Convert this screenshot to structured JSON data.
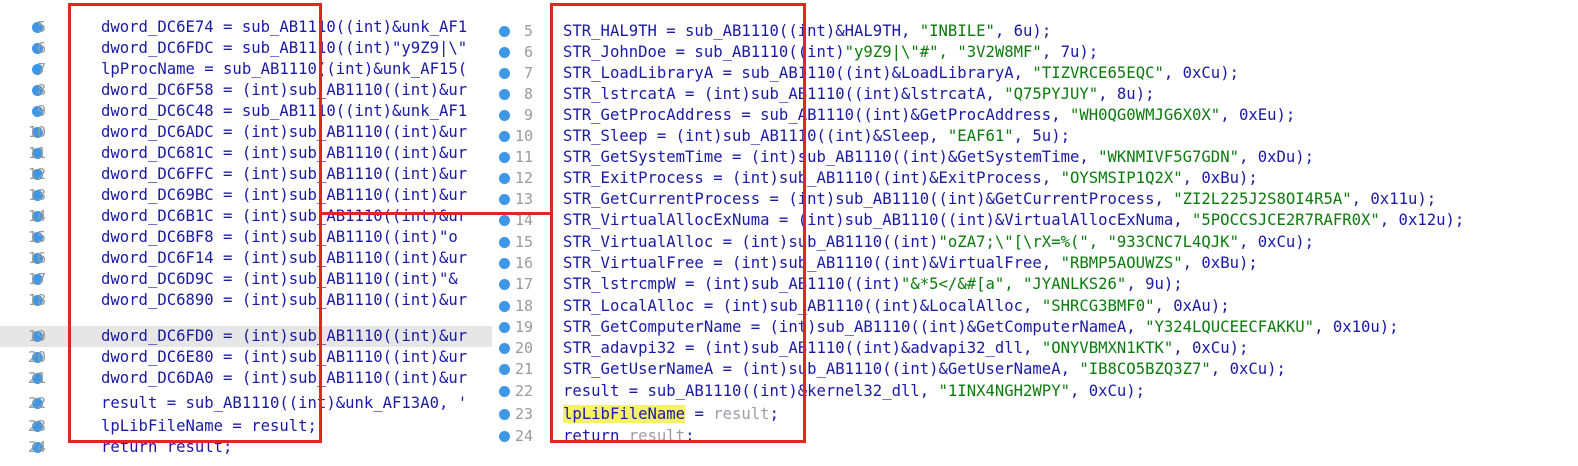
{
  "left_pane": {
    "lines": [
      {
        "num": "5",
        "code": "dword_DC6E74 = sub_AB1110((int)&unk_AF1"
      },
      {
        "num": "6",
        "code": "dword_DC6FDC = sub_AB1110((int)\"y9Z9|\\\""
      },
      {
        "num": "7",
        "code": "lpProcName = sub_AB1110((int)&unk_AF15("
      },
      {
        "num": "8",
        "code": "dword_DC6F58 = (int)sub_AB1110((int)&ur"
      },
      {
        "num": "9",
        "code": "dword_DC6C48 = sub_AB1110((int)&unk_AF1"
      },
      {
        "num": "10",
        "code": "dword_DC6ADC = (int)sub_AB1110((int)&ur"
      },
      {
        "num": "11",
        "code": "dword_DC681C = (int)sub_AB1110((int)&ur"
      },
      {
        "num": "12",
        "code": "dword_DC6FFC = (int)sub_AB1110((int)&ur"
      },
      {
        "num": "13",
        "code": "dword_DC69BC = (int)sub_AB1110((int)&ur"
      },
      {
        "num": "14",
        "code": "dword_DC6B1C = (int)sub_AB1110((int)&ur"
      },
      {
        "num": "15",
        "code": "dword_DC6BF8 = (int)sub_AB1110((int)\"o"
      },
      {
        "num": "16",
        "code": "dword_DC6F14 = (int)sub_AB1110((int)&ur"
      },
      {
        "num": "17",
        "code": "dword_DC6D9C = (int)sub_AB1110((int)\"&"
      },
      {
        "num": "18",
        "code": "dword_DC6890 = (int)sub_AB1110((int)&ur"
      },
      {
        "num": "19",
        "code": "dword_DC6FD0 = (int)sub_AB1110((int)&ur"
      },
      {
        "num": "20",
        "code": "dword_DC6E80 = (int)sub_AB1110((int)&ur"
      },
      {
        "num": "21",
        "code": "dword_DC6DA0 = (int)sub_AB1110((int)&ur"
      },
      {
        "num": "22",
        "code": "result = sub_AB1110((int)&unk_AF13A0, '"
      },
      {
        "num": "23",
        "code": "lpLibFileName = result;"
      },
      {
        "num": "24",
        "code": "return result;"
      }
    ]
  },
  "right_pane": {
    "lines": [
      {
        "num": "5",
        "pre": "STR_HAL9TH = sub_AB1110((int)&HAL9TH, ",
        "str": "\"INBILE\"",
        "post": ", 6u);"
      },
      {
        "num": "6",
        "pre": "STR_JohnDoe = sub_AB1110((int)",
        "str": "\"y9Z9|\\\"#\", \"3V2W8MF\"",
        "post": ", 7u);"
      },
      {
        "num": "7",
        "pre": "STR_LoadLibraryA = sub_AB1110((int)&LoadLibraryA, ",
        "str": "\"TIZVRCE65EQC\"",
        "post": ", 0xCu);"
      },
      {
        "num": "8",
        "pre": "STR_lstrcatA = (int)sub_AB1110((int)&lstrcatA, ",
        "str": "\"Q75PYJUY\"",
        "post": ", 8u);"
      },
      {
        "num": "9",
        "pre": "STR_GetProcAddress = sub_AB1110((int)&GetProcAddress, ",
        "str": "\"WH0QG0WMJG6X0X\"",
        "post": ", 0xEu);"
      },
      {
        "num": "10",
        "pre": "STR_Sleep = (int)sub_AB1110((int)&Sleep, ",
        "str": "\"EAF61\"",
        "post": ", 5u);"
      },
      {
        "num": "11",
        "pre": "STR_GetSystemTime = (int)sub_AB1110((int)&GetSystemTime, ",
        "str": "\"WKNMIVF5G7GDN\"",
        "post": ", 0xDu);"
      },
      {
        "num": "12",
        "pre": "STR_ExitProcess = (int)sub_AB1110((int)&ExitProcess, ",
        "str": "\"OYSMSIP1Q2X\"",
        "post": ", 0xBu);"
      },
      {
        "num": "13",
        "pre": "STR_GetCurrentProcess = (int)sub_AB1110((int)&GetCurrentProcess, ",
        "str": "\"ZI2L225J2S8OI4R5A\"",
        "post": ", 0x11u);"
      },
      {
        "num": "14",
        "pre": "STR_VirtualAllocExNuma = (int)sub_AB1110((int)&VirtualAllocExNuma, ",
        "str": "\"5POCCSJCE2R7RAFR0X\"",
        "post": ", 0x12u);"
      },
      {
        "num": "15",
        "pre": "STR_VirtualAlloc = (int)sub_AB1110((int)",
        "str": "\"oZA7;\\\"[\\rX=%(\", \"933CNC7L4QJK\"",
        "post": ", 0xCu);"
      },
      {
        "num": "16",
        "pre": "STR_VirtualFree = (int)sub_AB1110((int)&VirtualFree, ",
        "str": "\"RBMP5AOUWZS\"",
        "post": ", 0xBu);"
      },
      {
        "num": "17",
        "pre": "STR_lstrcmpW = (int)sub_AB1110((int)",
        "str": "\"&*5</&#[a\", \"JYANLKS26\"",
        "post": ", 9u);"
      },
      {
        "num": "18",
        "pre": "STR_LocalAlloc = (int)sub_AB1110((int)&LocalAlloc, ",
        "str": "\"SHRCG3BMF0\"",
        "post": ", 0xAu);"
      },
      {
        "num": "19",
        "pre": "STR_GetComputerName = (int)sub_AB1110((int)&GetComputerNameA, ",
        "str": "\"Y324LQUCEECFAKKU\"",
        "post": ", 0x10u);"
      },
      {
        "num": "20",
        "pre": "STR_adavpi32 = (int)sub_AB1110((int)&advapi32_dll, ",
        "str": "\"ONYVBMXN1KTK\"",
        "post": ", 0xCu);"
      },
      {
        "num": "21",
        "pre": "STR_GetUserNameA = (int)sub_AB1110((int)&GetUserNameA, ",
        "str": "\"IB8CO5BZQ3Z7\"",
        "post": ", 0xCu);"
      },
      {
        "num": "22",
        "pre": "result = sub_AB1110((int)&kernel32_dll, ",
        "str": "\"1INX4NGH2WPY\"",
        "post": ", 0xCu);"
      },
      {
        "num": "23",
        "hl": "lpLibFileName",
        "pre": " = ",
        "grey": "result",
        "post": ";"
      },
      {
        "num": "24",
        "pre": "return ",
        "grey": "result",
        "post": ";"
      }
    ]
  },
  "colors": {
    "breakpoint": "#3d97e6",
    "frame": "#e0261f",
    "string": "#0b7b0b",
    "code": "#1a1aa6",
    "highlight": "#f6f06a"
  }
}
